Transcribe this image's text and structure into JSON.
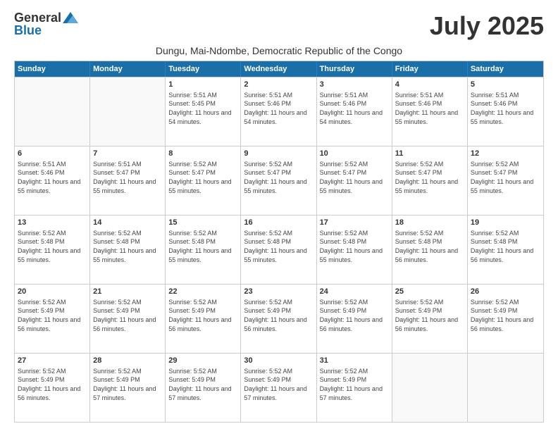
{
  "logo": {
    "general": "General",
    "blue": "Blue"
  },
  "title": "July 2025",
  "subtitle": "Dungu, Mai-Ndombe, Democratic Republic of the Congo",
  "header_days": [
    "Sunday",
    "Monday",
    "Tuesday",
    "Wednesday",
    "Thursday",
    "Friday",
    "Saturday"
  ],
  "weeks": [
    [
      {
        "day": "",
        "info": ""
      },
      {
        "day": "",
        "info": ""
      },
      {
        "day": "1",
        "info": "Sunrise: 5:51 AM\nSunset: 5:45 PM\nDaylight: 11 hours and 54 minutes."
      },
      {
        "day": "2",
        "info": "Sunrise: 5:51 AM\nSunset: 5:46 PM\nDaylight: 11 hours and 54 minutes."
      },
      {
        "day": "3",
        "info": "Sunrise: 5:51 AM\nSunset: 5:46 PM\nDaylight: 11 hours and 54 minutes."
      },
      {
        "day": "4",
        "info": "Sunrise: 5:51 AM\nSunset: 5:46 PM\nDaylight: 11 hours and 55 minutes."
      },
      {
        "day": "5",
        "info": "Sunrise: 5:51 AM\nSunset: 5:46 PM\nDaylight: 11 hours and 55 minutes."
      }
    ],
    [
      {
        "day": "6",
        "info": "Sunrise: 5:51 AM\nSunset: 5:46 PM\nDaylight: 11 hours and 55 minutes."
      },
      {
        "day": "7",
        "info": "Sunrise: 5:51 AM\nSunset: 5:47 PM\nDaylight: 11 hours and 55 minutes."
      },
      {
        "day": "8",
        "info": "Sunrise: 5:52 AM\nSunset: 5:47 PM\nDaylight: 11 hours and 55 minutes."
      },
      {
        "day": "9",
        "info": "Sunrise: 5:52 AM\nSunset: 5:47 PM\nDaylight: 11 hours and 55 minutes."
      },
      {
        "day": "10",
        "info": "Sunrise: 5:52 AM\nSunset: 5:47 PM\nDaylight: 11 hours and 55 minutes."
      },
      {
        "day": "11",
        "info": "Sunrise: 5:52 AM\nSunset: 5:47 PM\nDaylight: 11 hours and 55 minutes."
      },
      {
        "day": "12",
        "info": "Sunrise: 5:52 AM\nSunset: 5:47 PM\nDaylight: 11 hours and 55 minutes."
      }
    ],
    [
      {
        "day": "13",
        "info": "Sunrise: 5:52 AM\nSunset: 5:48 PM\nDaylight: 11 hours and 55 minutes."
      },
      {
        "day": "14",
        "info": "Sunrise: 5:52 AM\nSunset: 5:48 PM\nDaylight: 11 hours and 55 minutes."
      },
      {
        "day": "15",
        "info": "Sunrise: 5:52 AM\nSunset: 5:48 PM\nDaylight: 11 hours and 55 minutes."
      },
      {
        "day": "16",
        "info": "Sunrise: 5:52 AM\nSunset: 5:48 PM\nDaylight: 11 hours and 55 minutes."
      },
      {
        "day": "17",
        "info": "Sunrise: 5:52 AM\nSunset: 5:48 PM\nDaylight: 11 hours and 55 minutes."
      },
      {
        "day": "18",
        "info": "Sunrise: 5:52 AM\nSunset: 5:48 PM\nDaylight: 11 hours and 56 minutes."
      },
      {
        "day": "19",
        "info": "Sunrise: 5:52 AM\nSunset: 5:48 PM\nDaylight: 11 hours and 56 minutes."
      }
    ],
    [
      {
        "day": "20",
        "info": "Sunrise: 5:52 AM\nSunset: 5:49 PM\nDaylight: 11 hours and 56 minutes."
      },
      {
        "day": "21",
        "info": "Sunrise: 5:52 AM\nSunset: 5:49 PM\nDaylight: 11 hours and 56 minutes."
      },
      {
        "day": "22",
        "info": "Sunrise: 5:52 AM\nSunset: 5:49 PM\nDaylight: 11 hours and 56 minutes."
      },
      {
        "day": "23",
        "info": "Sunrise: 5:52 AM\nSunset: 5:49 PM\nDaylight: 11 hours and 56 minutes."
      },
      {
        "day": "24",
        "info": "Sunrise: 5:52 AM\nSunset: 5:49 PM\nDaylight: 11 hours and 56 minutes."
      },
      {
        "day": "25",
        "info": "Sunrise: 5:52 AM\nSunset: 5:49 PM\nDaylight: 11 hours and 56 minutes."
      },
      {
        "day": "26",
        "info": "Sunrise: 5:52 AM\nSunset: 5:49 PM\nDaylight: 11 hours and 56 minutes."
      }
    ],
    [
      {
        "day": "27",
        "info": "Sunrise: 5:52 AM\nSunset: 5:49 PM\nDaylight: 11 hours and 56 minutes."
      },
      {
        "day": "28",
        "info": "Sunrise: 5:52 AM\nSunset: 5:49 PM\nDaylight: 11 hours and 57 minutes."
      },
      {
        "day": "29",
        "info": "Sunrise: 5:52 AM\nSunset: 5:49 PM\nDaylight: 11 hours and 57 minutes."
      },
      {
        "day": "30",
        "info": "Sunrise: 5:52 AM\nSunset: 5:49 PM\nDaylight: 11 hours and 57 minutes."
      },
      {
        "day": "31",
        "info": "Sunrise: 5:52 AM\nSunset: 5:49 PM\nDaylight: 11 hours and 57 minutes."
      },
      {
        "day": "",
        "info": ""
      },
      {
        "day": "",
        "info": ""
      }
    ]
  ]
}
